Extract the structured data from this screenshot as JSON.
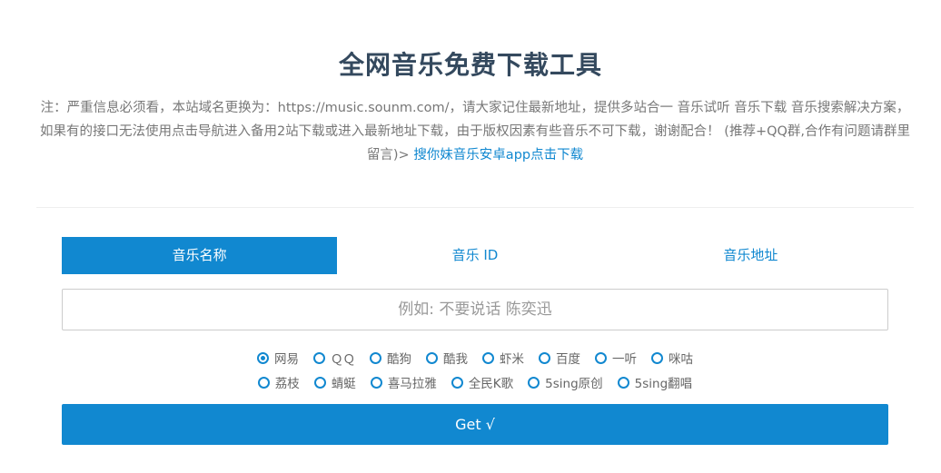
{
  "header": {
    "title": "全网音乐免费下载工具",
    "notice_text": "注：严重信息必须看，本站域名更换为：https://music.sounm.com/，请大家记住最新地址，提供多站合一 音乐试听 音乐下载 音乐搜索解决方案，如果有的接口无法使用点击导航进入备用2站下载或进入最新地址下载，由于版权因素有些音乐不可下载，谢谢配合！ (推荐+QQ群,合作有问题请群里留言)> ",
    "notice_link": "搜你妹音乐安卓app点击下载"
  },
  "tabs": [
    {
      "label": "音乐名称",
      "active": true
    },
    {
      "label": "音乐 ID",
      "active": false
    },
    {
      "label": "音乐地址",
      "active": false
    }
  ],
  "search": {
    "placeholder": "例如: 不要说话 陈奕迅",
    "value": ""
  },
  "sources_row1": [
    {
      "label": "网易",
      "checked": true
    },
    {
      "label": "ＱＱ",
      "checked": false
    },
    {
      "label": "酷狗",
      "checked": false
    },
    {
      "label": "酷我",
      "checked": false
    },
    {
      "label": "虾米",
      "checked": false
    },
    {
      "label": "百度",
      "checked": false
    },
    {
      "label": "一听",
      "checked": false
    },
    {
      "label": "咪咕",
      "checked": false
    }
  ],
  "sources_row2": [
    {
      "label": "荔枝",
      "checked": false
    },
    {
      "label": "蜻蜓",
      "checked": false
    },
    {
      "label": "喜马拉雅",
      "checked": false
    },
    {
      "label": "全民K歌",
      "checked": false
    },
    {
      "label": "5sing原创",
      "checked": false
    },
    {
      "label": "5sing翻唱",
      "checked": false
    }
  ],
  "submit": {
    "label": "Get √"
  },
  "colors": {
    "accent": "#1188d0",
    "title": "#34495e",
    "text_muted": "#777777"
  }
}
